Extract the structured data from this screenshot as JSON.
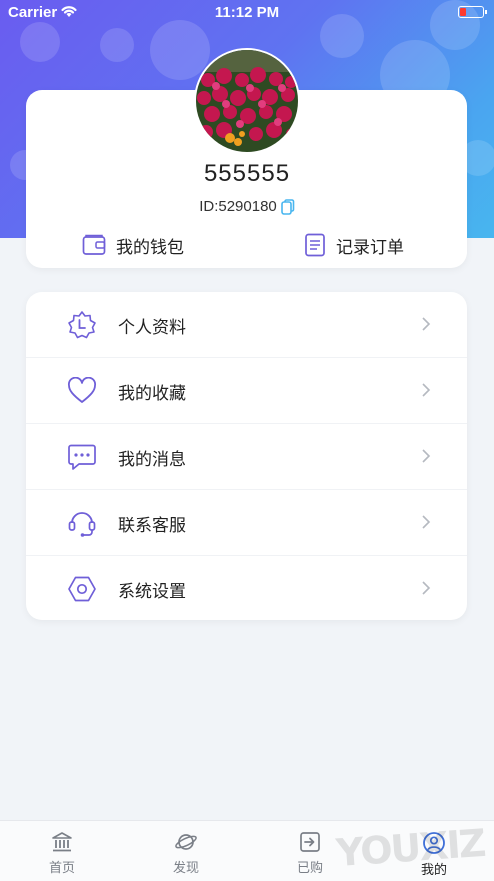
{
  "status": {
    "carrier": "Carrier",
    "time": "11:12 PM"
  },
  "profile": {
    "username": "555555",
    "id_text": "ID:5290180",
    "wallet_label": "我的钱包",
    "orders_label": "记录订单"
  },
  "menu": {
    "items": [
      {
        "label": "个人资料",
        "icon": "profile-badge-icon"
      },
      {
        "label": "我的收藏",
        "icon": "heart-icon"
      },
      {
        "label": "我的消息",
        "icon": "chat-bubble-icon"
      },
      {
        "label": "联系客服",
        "icon": "headset-icon"
      },
      {
        "label": "系统设置",
        "icon": "hexagon-gear-icon"
      }
    ]
  },
  "tabbar": {
    "tabs": [
      {
        "label": "首页",
        "icon": "bank-icon"
      },
      {
        "label": "发现",
        "icon": "planet-icon"
      },
      {
        "label": "已购",
        "icon": "purchased-icon"
      },
      {
        "label": "我的",
        "icon": "user-icon",
        "active": true
      }
    ]
  },
  "watermark": "YOUXIZ",
  "colors": {
    "accent": "#6f5fd8",
    "hero_start": "#6a5cf0",
    "hero_end": "#48b6ef",
    "copy_icon": "#49b6ef"
  }
}
